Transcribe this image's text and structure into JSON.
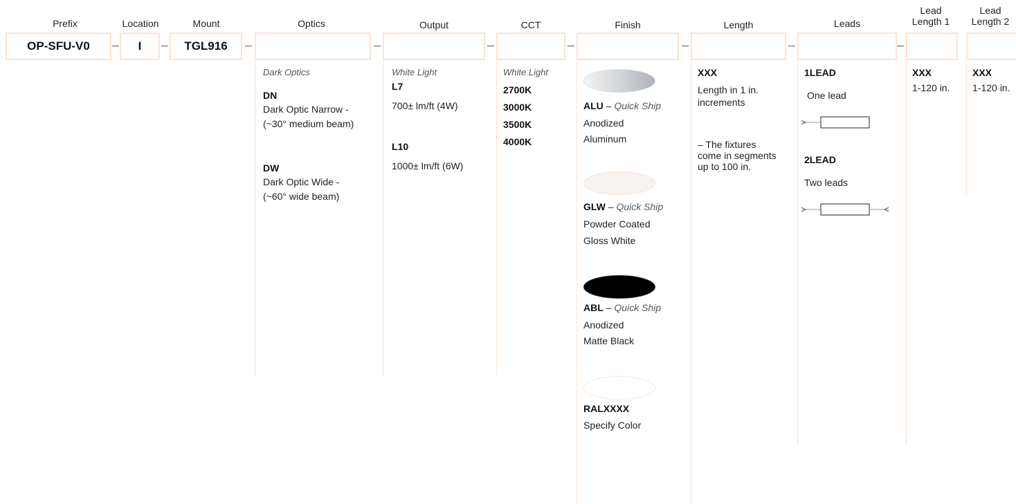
{
  "headers": {
    "prefix": "Prefix",
    "location": "Location",
    "mount": "Mount",
    "optics": "Optics",
    "output": "Output",
    "cct": "CCT",
    "finish": "Finish",
    "length": "Length",
    "leads": "Leads",
    "lead_length_1_a": "Lead",
    "lead_length_1_b": "Length 1",
    "lead_length_2_a": "Lead",
    "lead_length_2_b": "Length 2"
  },
  "boxes": {
    "prefix": "OP-SFU-V0",
    "location": "I",
    "mount": "TGL916"
  },
  "optics": {
    "category": "Dark Optics",
    "options": [
      {
        "code": "DN",
        "desc1": "Dark Optic Narrow -",
        "desc2": "(~30° medium beam)"
      },
      {
        "code": "DW",
        "desc1": "Dark Optic Wide -",
        "desc2": "(~60° wide beam)"
      }
    ]
  },
  "output": {
    "category": "White Light",
    "options": [
      {
        "code": "L7",
        "desc": "700± lm/ft (4W)"
      },
      {
        "code": "L10",
        "desc": "1000± lm/ft (6W)"
      }
    ]
  },
  "cct": {
    "category": "White Light",
    "options": [
      "2700K",
      "3000K",
      "3500K",
      "4000K"
    ]
  },
  "finish": {
    "colors": {
      "alu": "#d4d6d8",
      "glw": "#f6f2ef",
      "abl": "#000000",
      "ral": "#ffffff",
      "accent": "#fbe3d3"
    },
    "options": [
      {
        "code": "ALU",
        "tag": "Quick Ship",
        "sep": " – ",
        "desc1": "Anodized",
        "desc2": "Aluminum"
      },
      {
        "code": "GLW",
        "tag": "Quick Ship",
        "sep": " – ",
        "desc1": "Powder Coated",
        "desc2": "Gloss White"
      },
      {
        "code": "ABL",
        "tag": "Quick Ship",
        "sep": " – ",
        "desc1": "Anodized",
        "desc2": "Matte Black"
      },
      {
        "code": "RALXXXX",
        "desc1": "Specify Color"
      }
    ]
  },
  "length": {
    "code": "XXX",
    "desc1": "Length in 1 in.",
    "desc2": "increments",
    "note1": "– The fixtures",
    "note2": "come in segments",
    "note3": "up to 100 in."
  },
  "leads": {
    "options": [
      {
        "code": "1LEAD",
        "desc": "One lead"
      },
      {
        "code": "2LEAD",
        "desc": "Two leads"
      }
    ]
  },
  "lead_length_1": {
    "code": "XXX",
    "desc": "1-120 in."
  },
  "lead_length_2": {
    "code": "XXX",
    "desc": "1-120 in."
  }
}
